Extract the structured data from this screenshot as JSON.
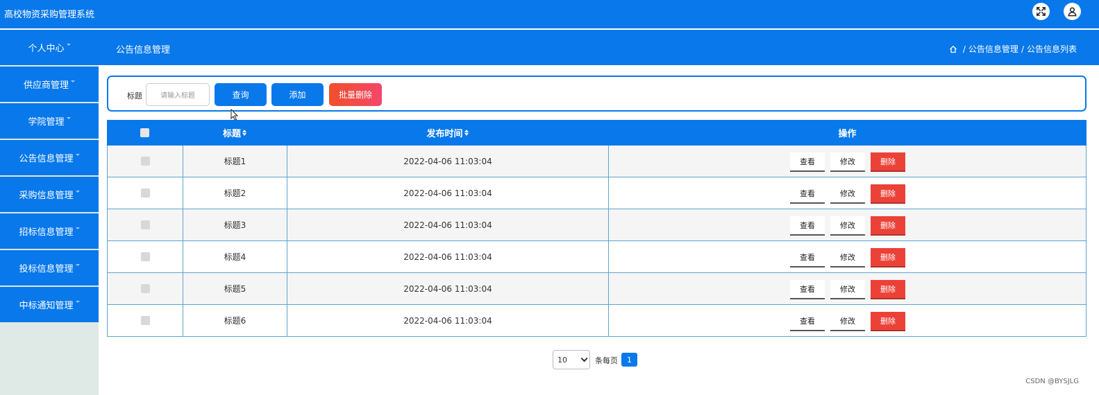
{
  "app": {
    "title": "高校物资采购管理系统"
  },
  "topbar": {
    "fullscreen_icon": "fullscreen-icon",
    "user_icon": "user-icon"
  },
  "sidebar": {
    "items": [
      {
        "label": "个人中心"
      },
      {
        "label": "供应商管理"
      },
      {
        "label": "学院管理"
      },
      {
        "label": "公告信息管理"
      },
      {
        "label": "采购信息管理"
      },
      {
        "label": "招标信息管理"
      },
      {
        "label": "投标信息管理"
      },
      {
        "label": "中标通知管理"
      }
    ]
  },
  "header": {
    "page_title": "公告信息管理",
    "breadcrumb": {
      "home_icon": "home-icon",
      "sep": "/",
      "level1": "公告信息管理",
      "level2": "公告信息列表"
    }
  },
  "search": {
    "label": "标题",
    "placeholder": "请输入标题",
    "query_label": "查询",
    "add_label": "添加",
    "batch_delete_label": "批量删除"
  },
  "table": {
    "columns": {
      "title": "标题",
      "publish_time": "发布时间",
      "actions": "操作"
    },
    "action_labels": {
      "view": "查看",
      "edit": "修改",
      "delete": "删除"
    },
    "rows": [
      {
        "title": "标题1",
        "time": "2022-04-06 11:03:04"
      },
      {
        "title": "标题2",
        "time": "2022-04-06 11:03:04"
      },
      {
        "title": "标题3",
        "time": "2022-04-06 11:03:04"
      },
      {
        "title": "标题4",
        "time": "2022-04-06 11:03:04"
      },
      {
        "title": "标题5",
        "time": "2022-04-06 11:03:04"
      },
      {
        "title": "标题6",
        "time": "2022-04-06 11:03:04"
      }
    ]
  },
  "pagination": {
    "page_size": "10",
    "per_page_label": "条每页",
    "current_page": "1"
  },
  "watermark": "CSDN @BYSJLG",
  "colors": {
    "primary": "#0878eb",
    "danger": "#ec4137",
    "sidebar_bg": "#dfe9e6"
  }
}
